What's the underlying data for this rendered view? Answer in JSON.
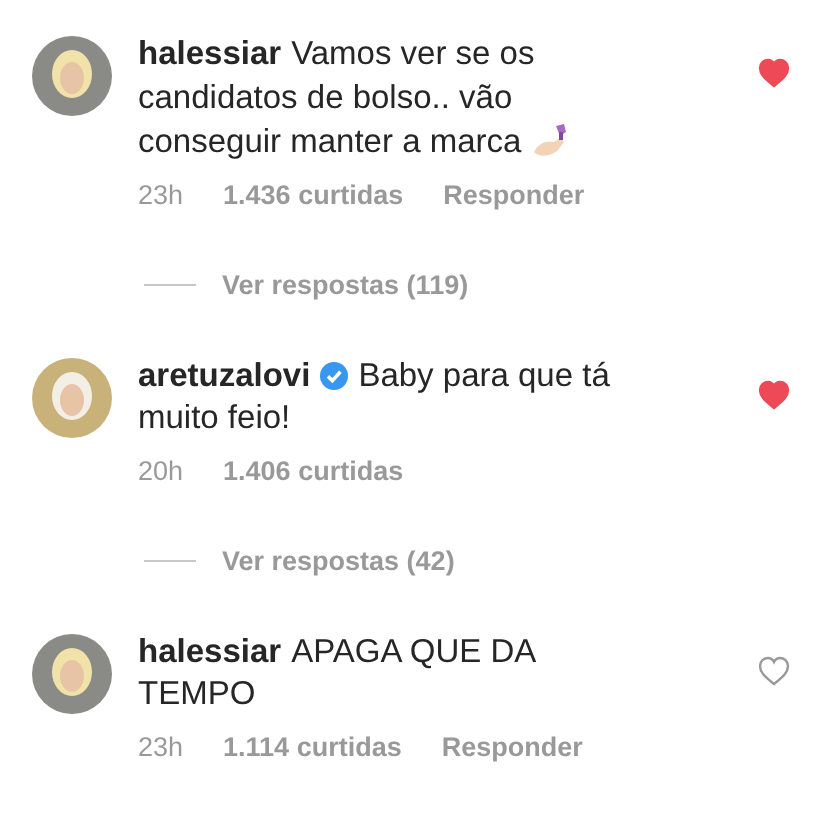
{
  "comments": [
    {
      "username": "halessiar",
      "verified": false,
      "text": "Vamos ver se os candidatos de bolso.. vão conseguir manter a marca",
      "nail_emoji": true,
      "liked": true,
      "time": "23h",
      "likes": "1.436 curtidas",
      "reply": "Responder",
      "view_replies": "Ver respostas (119)"
    },
    {
      "username": "aretuzalovi",
      "verified": true,
      "text": "Baby para que tá muito feio!",
      "nail_emoji": false,
      "liked": true,
      "time": "20h",
      "likes": "1.406 curtidas",
      "view_replies": "Ver respostas (42)"
    },
    {
      "username": "halessiar",
      "verified": false,
      "text": "APAGA QUE DA TEMPO",
      "nail_emoji": false,
      "liked": false,
      "time": "23h",
      "likes": "1.114 curtidas",
      "reply": "Responder"
    }
  ]
}
